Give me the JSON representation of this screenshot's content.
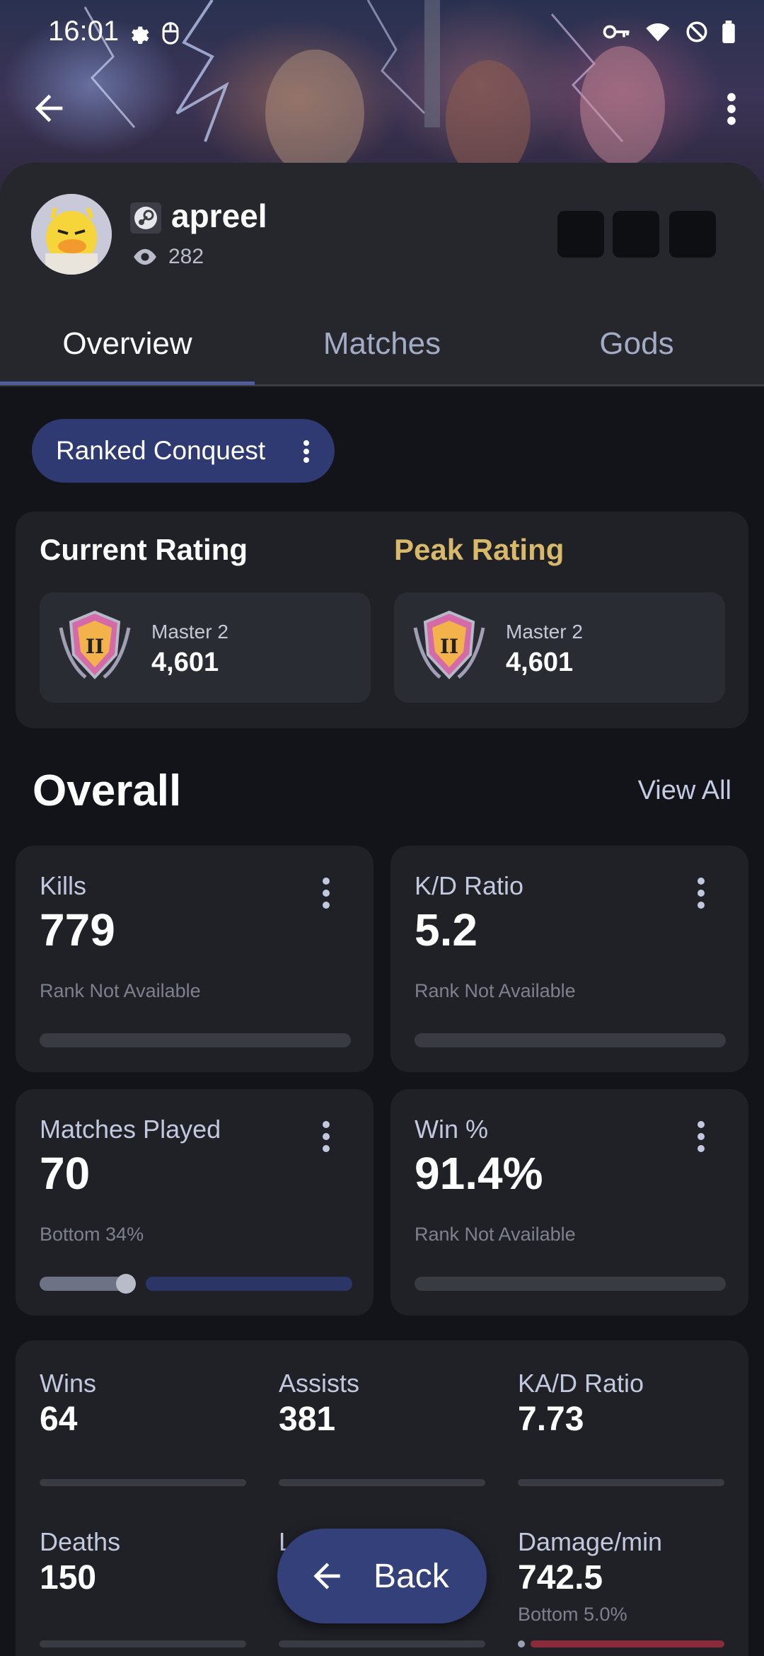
{
  "status_bar": {
    "time": "16:01"
  },
  "profile": {
    "username": "apreel",
    "views": "282"
  },
  "tabs": [
    {
      "label": "Overview"
    },
    {
      "label": "Matches"
    },
    {
      "label": "Gods"
    }
  ],
  "mode_chip": {
    "label": "Ranked Conquest"
  },
  "ratings": {
    "current": {
      "title": "Current Rating",
      "rank": "Master 2",
      "value": "4,601",
      "emblem_numeral": "II"
    },
    "peak": {
      "title": "Peak Rating",
      "rank": "Master 2",
      "value": "4,601",
      "emblem_numeral": "II"
    }
  },
  "overall": {
    "title": "Overall",
    "view_all": "View All",
    "cards": [
      {
        "label": "Kills",
        "value": "779",
        "sub": "Rank Not Available"
      },
      {
        "label": "K/D Ratio",
        "value": "5.2",
        "sub": "Rank Not Available"
      },
      {
        "label": "Matches Played",
        "value": "70",
        "sub": "Bottom 34%",
        "percentile": 0.34
      },
      {
        "label": "Win %",
        "value": "91.4%",
        "sub": "Rank Not Available"
      }
    ],
    "grid": [
      {
        "label": "Wins",
        "value": "64"
      },
      {
        "label": "Assists",
        "value": "381"
      },
      {
        "label": "KA/D Ratio",
        "value": "7.73"
      },
      {
        "label": "Deaths",
        "value": "150"
      },
      {
        "label": "L",
        "value": ""
      },
      {
        "label": "Damage/min",
        "value": "742.5",
        "sub": "Bottom 5.0%",
        "percentile": 0.05
      }
    ]
  },
  "fab": {
    "label": "Back"
  },
  "colors": {
    "accent": "#2f3a72",
    "peak_gold": "#d8b96a",
    "damage_bar": "#8a2a3a",
    "matches_bar": "#2b3566"
  }
}
